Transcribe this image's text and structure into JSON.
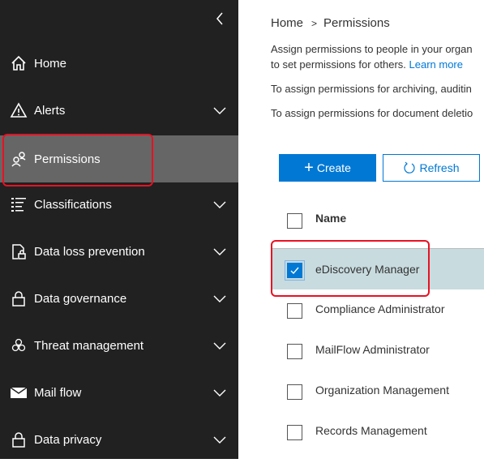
{
  "sidebar": {
    "collapse_icon": "chevron-left-icon",
    "items": [
      {
        "label": "Home",
        "icon": "home-icon",
        "expandable": false,
        "active": false
      },
      {
        "label": "Alerts",
        "icon": "warning-icon",
        "expandable": true,
        "active": false
      },
      {
        "label": "Permissions",
        "icon": "people-icon",
        "expandable": false,
        "active": true
      },
      {
        "label": "Classifications",
        "icon": "list-icon",
        "expandable": true,
        "active": false
      },
      {
        "label": "Data loss prevention",
        "icon": "document-lock-icon",
        "expandable": true,
        "active": false
      },
      {
        "label": "Data governance",
        "icon": "lock-icon",
        "expandable": true,
        "active": false
      },
      {
        "label": "Threat management",
        "icon": "biohazard-icon",
        "expandable": true,
        "active": false
      },
      {
        "label": "Mail flow",
        "icon": "mail-icon",
        "expandable": true,
        "active": false
      },
      {
        "label": "Data privacy",
        "icon": "lock-icon",
        "expandable": true,
        "active": false
      }
    ]
  },
  "breadcrumb": {
    "home": "Home",
    "separator": ">",
    "current": "Permissions"
  },
  "description": {
    "line1": "Assign permissions to people in your organ",
    "line2_text": "to set permissions for others. ",
    "learn_more": "Learn more",
    "line3": "To assign permissions for archiving, auditin",
    "line4": "To assign permissions for document deletio"
  },
  "toolbar": {
    "create_label": "Create",
    "create_icon": "+",
    "refresh_label": "Refresh"
  },
  "table": {
    "column_header": "Name",
    "rows": [
      {
        "name": "eDiscovery Manager",
        "checked": true
      },
      {
        "name": "Compliance Administrator",
        "checked": false
      },
      {
        "name": "MailFlow Administrator",
        "checked": false
      },
      {
        "name": "Organization Management",
        "checked": false
      },
      {
        "name": "Records Management",
        "checked": false
      }
    ]
  },
  "colors": {
    "accent": "#0078d4",
    "sidebar_bg": "#212121",
    "active_item_bg": "#666666",
    "selected_row_bg": "#c8dbdf",
    "highlight": "#e81123"
  }
}
